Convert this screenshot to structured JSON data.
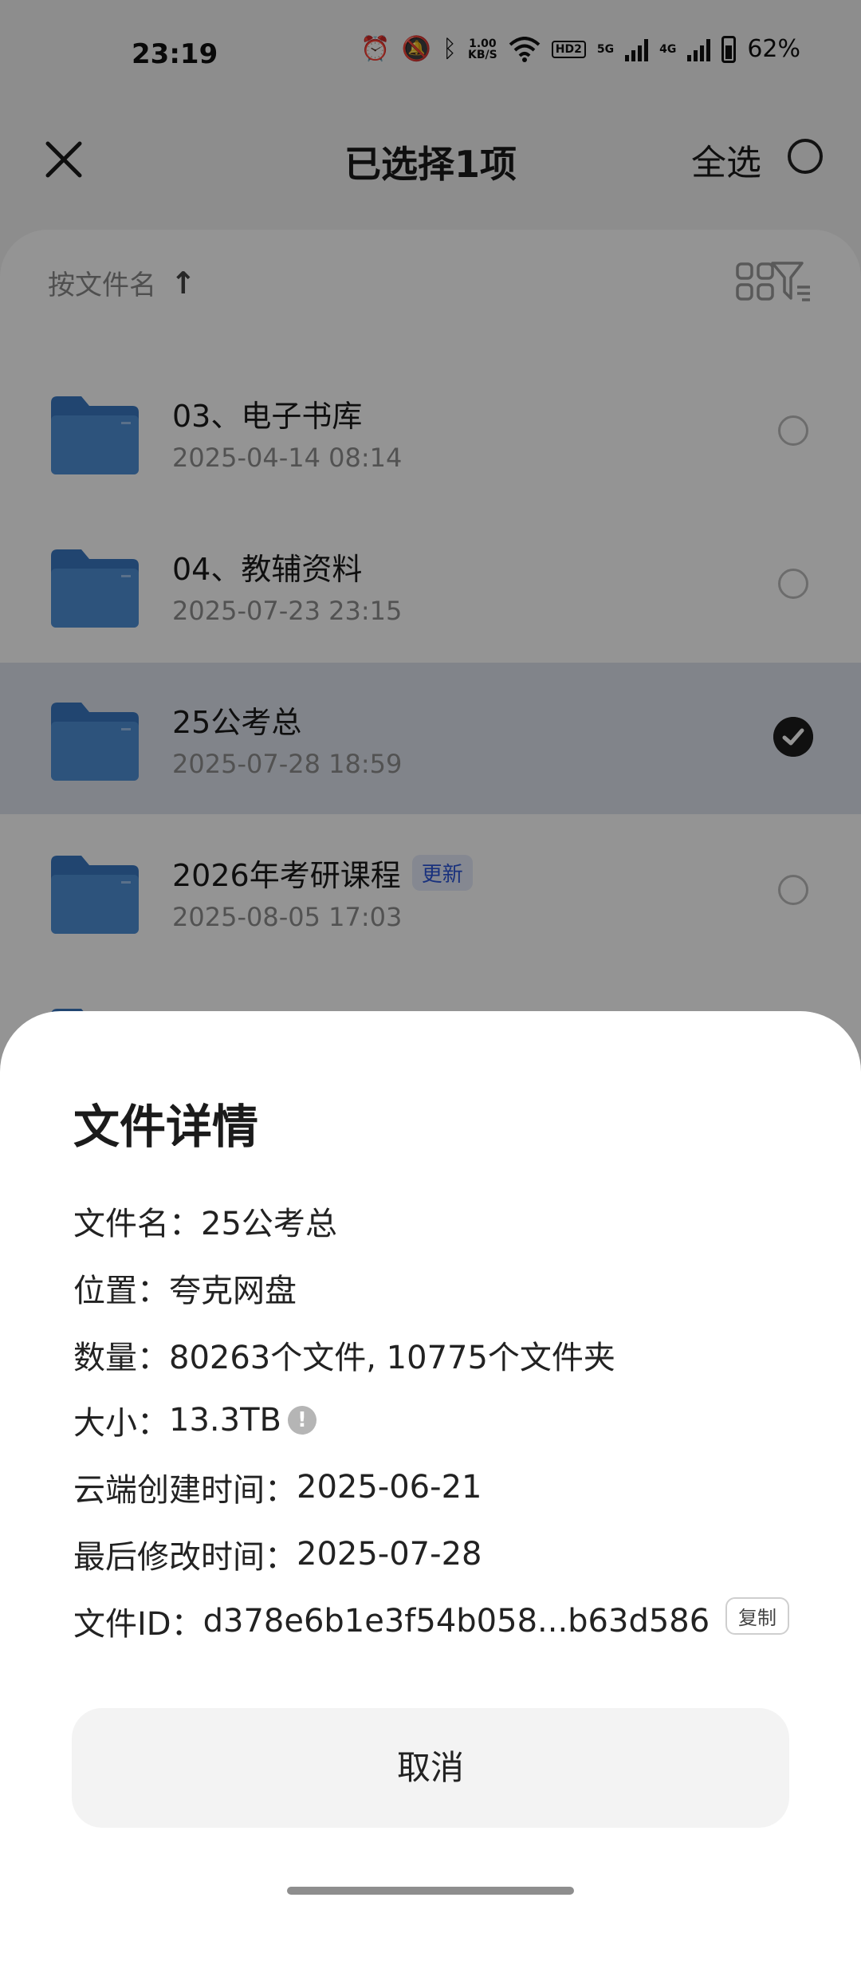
{
  "status_bar": {
    "time": "23:19",
    "net_speed_value": "1.00",
    "net_speed_unit": "KB/S",
    "hd_label": "HD2",
    "sig1_label": "5G",
    "sig2_label": "4G",
    "battery": "62%"
  },
  "header": {
    "title": "已选择1项",
    "select_all": "全选"
  },
  "sort": {
    "label": "按文件名",
    "arrow": "↑"
  },
  "files": [
    {
      "name": "03、电子书库",
      "date": "2025-04-14 08:14",
      "selected": false,
      "badge": ""
    },
    {
      "name": "04、教辅资料",
      "date": "2025-07-23 23:15",
      "selected": false,
      "badge": ""
    },
    {
      "name": "25公考总",
      "date": "2025-07-28 18:59",
      "selected": true,
      "badge": ""
    },
    {
      "name": "2026年考研课程",
      "date": "2025-08-05 17:03",
      "selected": false,
      "badge": "更新"
    }
  ],
  "sheet": {
    "title": "文件详情",
    "rows": {
      "name": {
        "label": "文件名：",
        "value": "25公考总"
      },
      "location": {
        "label": "位置：",
        "value": "夸克网盘"
      },
      "count": {
        "label": "数量：",
        "value": "80263个文件, 10775个文件夹"
      },
      "size": {
        "label": "大小：",
        "value": "13.3TB"
      },
      "created": {
        "label": "云端创建时间：",
        "value": "2025-06-21"
      },
      "modified": {
        "label": "最后修改时间：",
        "value": "2025-07-28"
      },
      "file_id": {
        "label": "文件ID：",
        "value": "d378e6b1e3f54b058...b63d586"
      }
    },
    "copy_label": "复制",
    "cancel_label": "取消"
  },
  "colors": {
    "folder": "#4f8fd6",
    "folder_dark": "#3a78c2",
    "badge_text": "#2b55d8",
    "selected_row": "#dfe4ee"
  }
}
